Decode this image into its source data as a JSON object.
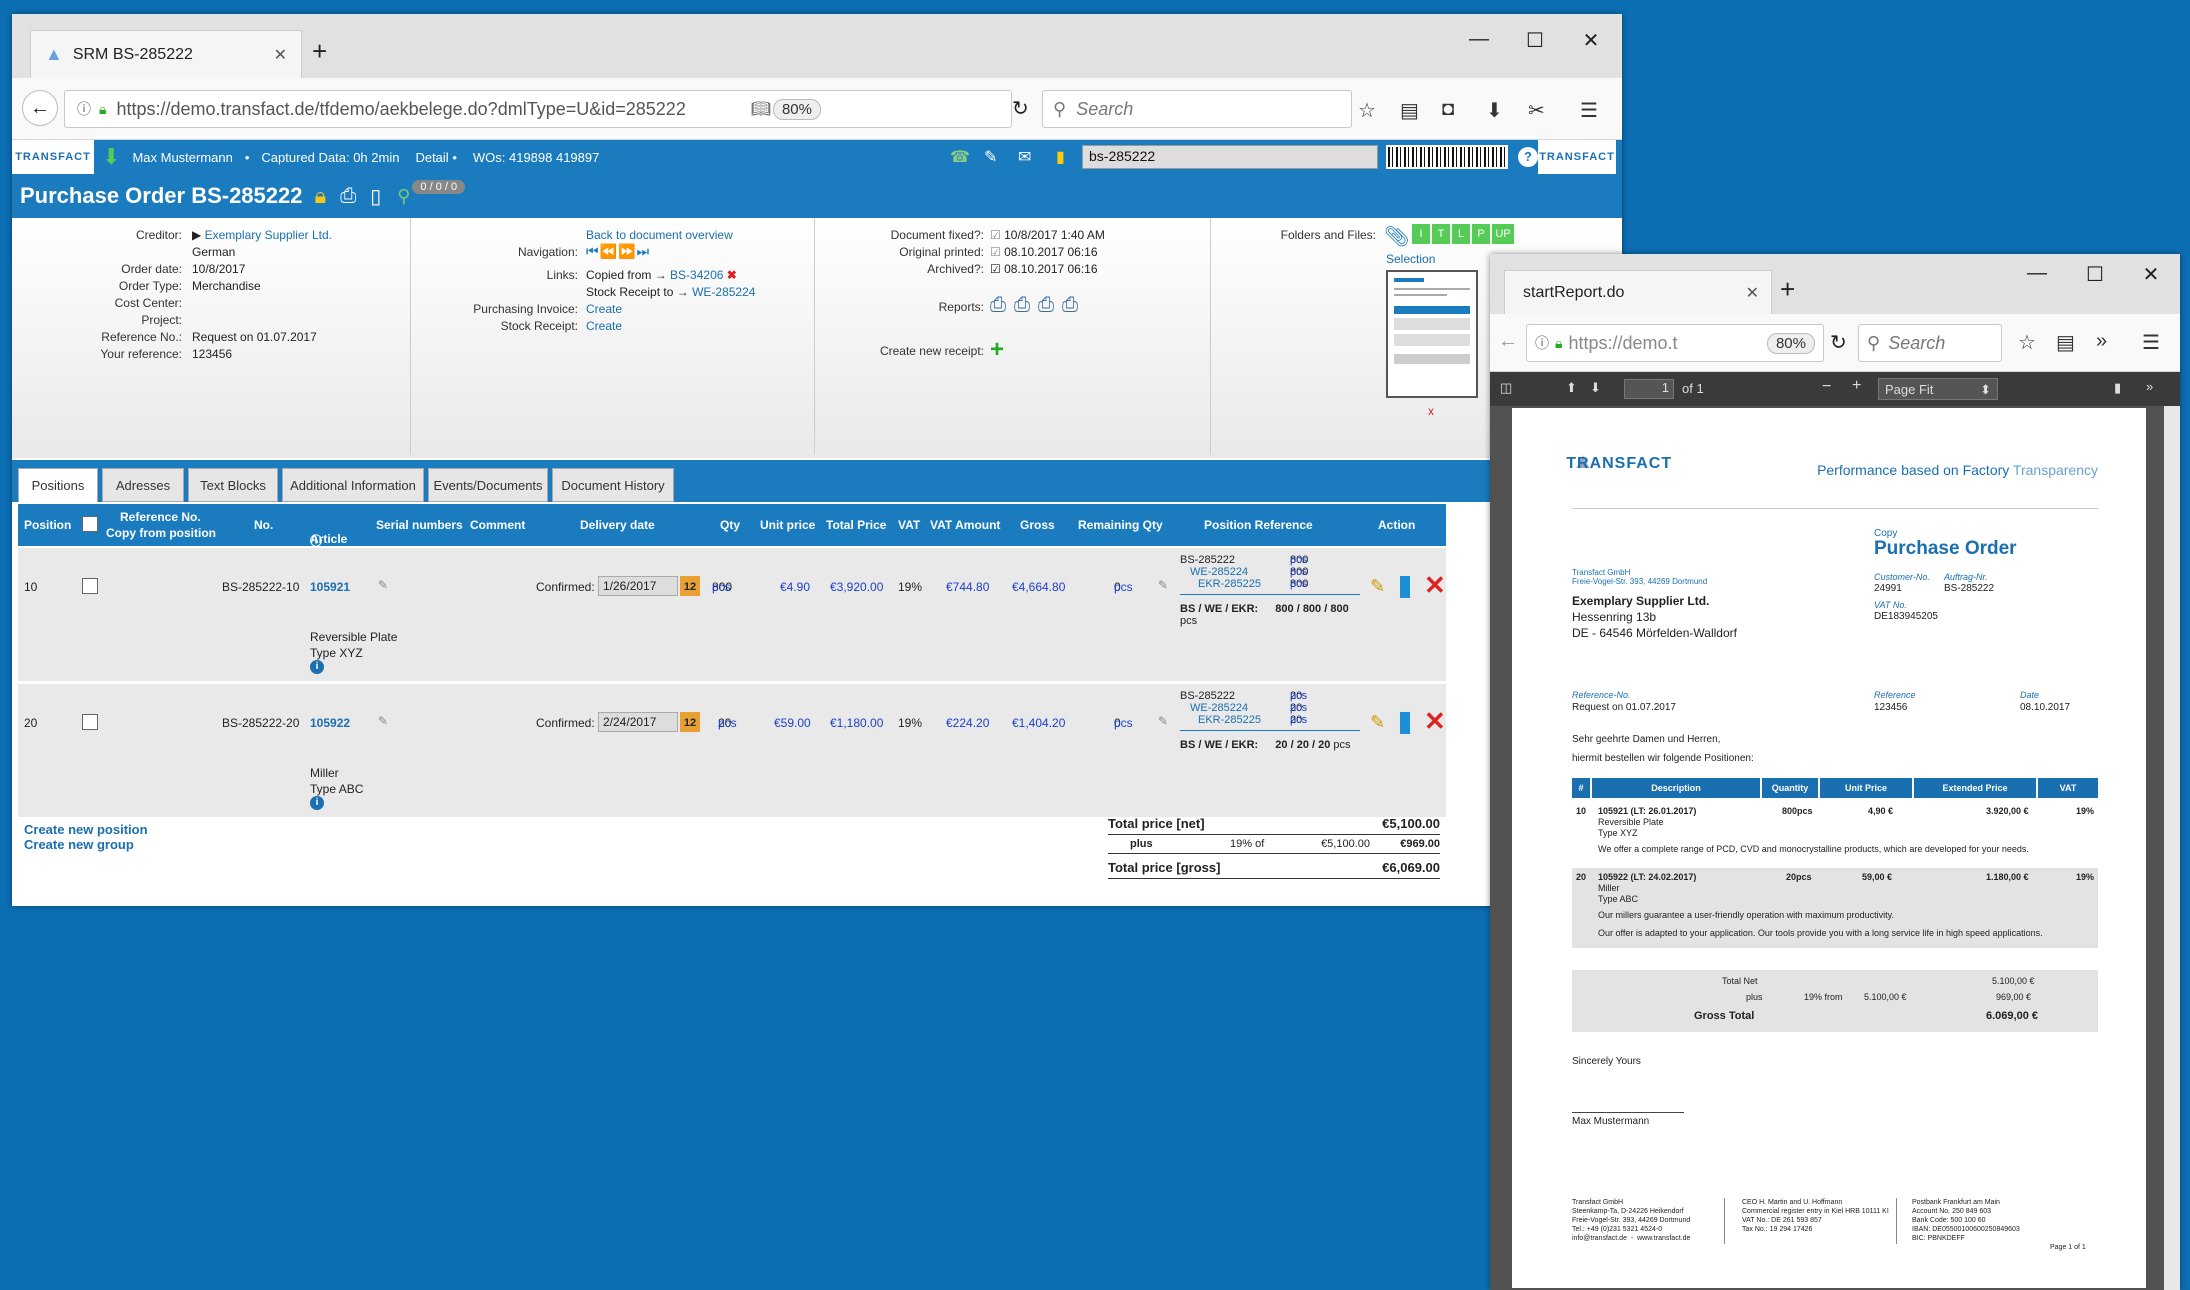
{
  "browser1": {
    "tab_title": "SRM BS-285222",
    "url": "https://demo.transfact.de/tfdemo/aekbelege.do?dmlType=U&id=285222",
    "zoom": "80%",
    "search_placeholder": "Search"
  },
  "app": {
    "logo_text": "TRANSFACT",
    "user": "Max Mustermann",
    "captured": "Captured Data: 0h 2min",
    "detail": "Detail",
    "wos": "WOs: 419898 419897",
    "search_value": "bs-285222",
    "help": "?",
    "title": "Purchase Order BS-285222",
    "counter": "0 / 0 / 0"
  },
  "form": {
    "creditor_label": "Creditor:",
    "creditor_value": "Exemplary Supplier Ltd.",
    "language": "German",
    "order_date_label": "Order date:",
    "order_date": "10/8/2017",
    "order_type_label": "Order Type:",
    "order_type": "Merchandise",
    "cost_center_label": "Cost Center:",
    "project_label": "Project:",
    "ref_no_label": "Reference No.:",
    "ref_no": "Request on 01.07.2017",
    "your_ref_label": "Your reference:",
    "your_ref": "123456",
    "back_link": "Back to document overview",
    "navigation_label": "Navigation:",
    "links_label": "Links:",
    "copied_from": "Copied from →",
    "copied_from_link": "BS-34206",
    "stock_receipt_to": "Stock Receipt to →",
    "stock_receipt_link": "WE-285224",
    "purch_invoice_label": "Purchasing Invoice:",
    "purch_invoice_link": "Create",
    "stock_receipt_label": "Stock Receipt:",
    "stock_receipt_create": "Create",
    "doc_fixed_label": "Document fixed?:",
    "doc_fixed": "10/8/2017 1:40 AM",
    "orig_printed_label": "Original printed:",
    "orig_printed": "08.10.2017 06:16",
    "archived_label": "Archived?:",
    "archived": "08.10.2017 06:16",
    "reports_label": "Reports:",
    "new_receipt_label": "Create new receipt:",
    "folders_label": "Folders and Files:",
    "folder_buttons": [
      "I",
      "T",
      "L",
      "P",
      "UP"
    ],
    "selection": "Selection",
    "x_mark": "x"
  },
  "tabs": [
    "Positions",
    "Adresses",
    "Text Blocks",
    "Additional Information",
    "Events/Documents",
    "Document History"
  ],
  "table": {
    "headers": {
      "position": "Position",
      "ref_no": "Reference No.",
      "copy_from": "Copy from position",
      "no": "No.",
      "article": "Article",
      "serial": "Serial numbers",
      "comment": "Comment",
      "delivery": "Delivery date",
      "qty": "Qty",
      "unit_price": "Unit price",
      "total_price": "Total Price",
      "vat": "VAT",
      "vat_amount": "VAT Amount",
      "gross": "Gross",
      "remaining": "Remaining Qty",
      "pos_ref": "Position Reference",
      "action": "Action"
    },
    "rows": [
      {
        "pos": "10",
        "no": "BS-285222-10",
        "article": "105921",
        "confirmed": "Confirmed:",
        "date": "1/26/2017",
        "qty": "800",
        "unit": "pcs",
        "unit_price": "€4.90",
        "total": "€3,920.00",
        "vat": "19%",
        "vat_amount": "€744.80",
        "gross": "€4,664.80",
        "remaining": "0",
        "desc1": "Reversible Plate",
        "desc2": "Type XYZ",
        "ref1": "BS-285222",
        "ref1q": "800",
        "ref2": "WE-285224",
        "ref2q": "800",
        "ref3": "EKR-285225",
        "ref3q": "800",
        "summary_label": "BS / WE / EKR:",
        "summary": "800 / 800 / 800",
        "summary_unit": "pcs"
      },
      {
        "pos": "20",
        "no": "BS-285222-20",
        "article": "105922",
        "confirmed": "Confirmed:",
        "date": "2/24/2017",
        "qty": "20",
        "unit": "pcs",
        "unit_price": "€59.00",
        "total": "€1,180.00",
        "vat": "19%",
        "vat_amount": "€224.20",
        "gross": "€1,404.20",
        "remaining": "0",
        "desc1": "Miller",
        "desc2": "Type ABC",
        "ref1": "BS-285222",
        "ref1q": "20",
        "ref2": "WE-285224",
        "ref2q": "20",
        "ref3": "EKR-285225",
        "ref3q": "20",
        "summary_label": "BS / WE / EKR:",
        "summary": "20 / 20 / 20",
        "summary_unit": "pcs"
      }
    ],
    "create_position": "Create new position",
    "create_group": "Create new group",
    "total_net_label": "Total price [net]",
    "total_net": "€5,100.00",
    "plus": "plus",
    "vat_of": "19% of",
    "vat_base": "€5,100.00",
    "vat_total": "€969.00",
    "total_gross_label": "Total price [gross]",
    "total_gross": "€6,069.00"
  },
  "browser2": {
    "tab_title": "startReport.do",
    "url": "https://demo.t",
    "zoom": "80%",
    "search_placeholder": "Search",
    "page_input": "1",
    "page_of": "of 1",
    "page_fit": "Page Fit"
  },
  "pdf": {
    "logo": "TRANSFACT",
    "tagline1": "Performance based on Factory",
    "tagline2": "Transparency",
    "copy": "Copy",
    "doc_title": "Purchase Order",
    "sender": "Transfact GmbH\nFreie-Vogel-Str. 393, 44269 Dortmund",
    "cust_no_label": "Customer-No.",
    "cust_no": "24991",
    "auftrag_label": "Auftrag-Nr.",
    "auftrag": "BS-285222",
    "vat_no_label": "VAT No.",
    "vat_no": "DE183945205",
    "recipient1": "Exemplary Supplier Ltd.",
    "recipient2": "Hessenring 13b",
    "recipient3": "DE - 64546 Mörfelden-Walldorf",
    "ref_no_label": "Reference-No.",
    "ref_no": "Request on 01.07.2017",
    "reference_label": "Reference",
    "reference": "123456",
    "date_label": "Date",
    "date": "08.10.2017",
    "greeting": "Sehr geehrte Damen und Herren,",
    "intro": "hiermit bestellen wir folgende Positionen:",
    "cols": [
      "#",
      "Description",
      "Quantity",
      "Unit Price",
      "Extended Price",
      "VAT"
    ],
    "item1_no": "10",
    "item1_head": "105921  (LT: 26.01.2017)",
    "item1_qty": "800pcs",
    "item1_unit": "4,90  €",
    "item1_ext": "3.920,00 €",
    "item1_vat": "19%",
    "item1_d1": "Reversible Plate",
    "item1_d2": "Type XYZ",
    "item1_text": "We offer a complete range of PCD, CVD and monocrystalline products, which are developed for your needs.",
    "item2_no": "20",
    "item2_head": "105922  (LT: 24.02.2017)",
    "item2_qty": "20pcs",
    "item2_unit": "59,00  €",
    "item2_ext": "1.180,00 €",
    "item2_vat": "19%",
    "item2_d1": "Miller",
    "item2_d2": "Type ABC",
    "item2_text1": "Our millers guarantee a user-friendly operation with maximum productivity.",
    "item2_text2": "Our offer is adapted to your application. Our tools provide you with a long service life in high speed applications.",
    "total_net_label": "Total Net",
    "total_net": "5.100,00 €",
    "plus": "plus",
    "vat_from": "19% from",
    "vat_base": "5.100,00 €",
    "vat_value": "969,00 €",
    "gross_label": "Gross Total",
    "gross": "6.069,00 €",
    "closing": "Sincerely Yours",
    "signer": "Max Mustermann",
    "footer1": "Transfact GmbH\nSteenkamp-Ta, D-24226 Heikendorf\nFreie-Vogel-Str. 393, 44269 Dortmund\nTel.: +49 (0)231 5321 4524-0\ninfo@transfact.de  -  www.transfact.de",
    "footer2": "CEO H. Martin and U. Hoffmann\nCommercial register entry in Kiel HRB 10111 KI\nVAT No.: DE 261 593 857\nTax No.: 19 294 17426",
    "footer3": "Postbank Frankfurt am Main\nAccount No. 250 849 603\nBank Code: 500 100 60\nIBAN: DE05500100600250849603\nBIC: PBNKDEFF",
    "page": "Page 1 of 1"
  }
}
